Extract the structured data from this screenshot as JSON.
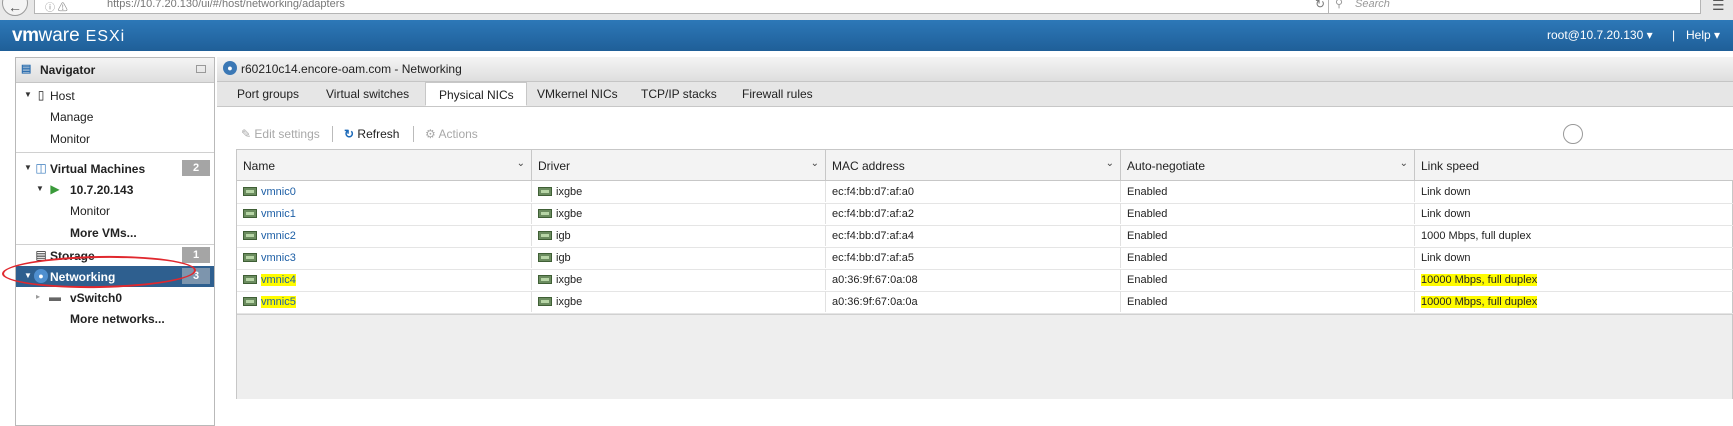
{
  "browser": {
    "url": "https://10.7.20.130/ui/#/host/networking/adapters",
    "search_placeholder": "Search"
  },
  "header": {
    "logo_vm": "vm",
    "logo_ware": "ware",
    "logo_esxi": "ESXi",
    "user": "root@10.7.20.130 ▾",
    "separator": "|",
    "help": "Help ▾"
  },
  "navigator": {
    "title": "Navigator",
    "host": "Host",
    "manage": "Manage",
    "monitor": "Monitor",
    "virtual_machines": "Virtual Machines",
    "vm_count": "2",
    "vm_name": "10.7.20.143",
    "vm_monitor": "Monitor",
    "more_vms": "More VMs...",
    "storage": "Storage",
    "storage_count": "1",
    "networking": "Networking",
    "networking_count": "3",
    "vswitch": "vSwitch0",
    "more_networks": "More networks..."
  },
  "main": {
    "title": "r60210c14.encore-oam.com - Networking",
    "tabs": [
      "Port groups",
      "Virtual switches",
      "Physical NICs",
      "VMkernel NICs",
      "TCP/IP stacks",
      "Firewall rules"
    ],
    "active_tab": "Physical NICs",
    "toolbar": {
      "edit_settings": "Edit settings",
      "refresh": "Refresh",
      "actions": "Actions"
    },
    "columns": [
      "Name",
      "Driver",
      "MAC address",
      "Auto-negotiate",
      "Link speed"
    ],
    "rows": [
      {
        "name": "vmnic0",
        "driver": "ixgbe",
        "mac": "ec:f4:bb:d7:af:a0",
        "auto": "Enabled",
        "speed": "Link down"
      },
      {
        "name": "vmnic1",
        "driver": "ixgbe",
        "mac": "ec:f4:bb:d7:af:a2",
        "auto": "Enabled",
        "speed": "Link down"
      },
      {
        "name": "vmnic2",
        "driver": "igb",
        "mac": "ec:f4:bb:d7:af:a4",
        "auto": "Enabled",
        "speed": "1000 Mbps, full duplex"
      },
      {
        "name": "vmnic3",
        "driver": "igb",
        "mac": "ec:f4:bb:d7:af:a5",
        "auto": "Enabled",
        "speed": "Link down"
      },
      {
        "name": "vmnic4",
        "driver": "ixgbe",
        "mac": "a0:36:9f:67:0a:08",
        "auto": "Enabled",
        "speed": "10000 Mbps, full duplex"
      },
      {
        "name": "vmnic5",
        "driver": "ixgbe",
        "mac": "a0:36:9f:67:0a:0a",
        "auto": "Enabled",
        "speed": "10000 Mbps, full duplex"
      }
    ]
  },
  "colors": {
    "header_blue": "#2170b0",
    "selected_nav": "#2e5f8f",
    "highlight": "#fffc00",
    "annotation_red": "#e0282e",
    "link": "#1d5fa6"
  }
}
